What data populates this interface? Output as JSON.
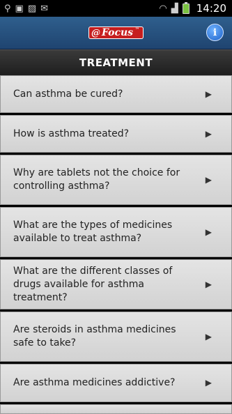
{
  "statusbar": {
    "time": "14:20",
    "left_icons": [
      "usb-icon",
      "sd-card-icon",
      "image-icon",
      "gmail-icon"
    ],
    "right_icons": [
      "wifi-icon",
      "signal-icon",
      "battery-icon"
    ]
  },
  "appbar": {
    "logo_text": "Focus",
    "logo_mark": "@",
    "logo_tm": "™",
    "info_label": "i"
  },
  "section": {
    "title": "TREATMENT"
  },
  "items": [
    {
      "label": "Can asthma be cured?"
    },
    {
      "label": "How is asthma treated?"
    },
    {
      "label": "Why are tablets not the choice for controlling asthma?"
    },
    {
      "label": "What are the types of medicines available to treat asthma?"
    },
    {
      "label": "What are the different classes of drugs available for asthma treatment?"
    },
    {
      "label": "Are steroids in asthma medicines safe to take?"
    },
    {
      "label": "Are asthma medicines addictive?"
    }
  ],
  "arrow_glyph": "▶"
}
